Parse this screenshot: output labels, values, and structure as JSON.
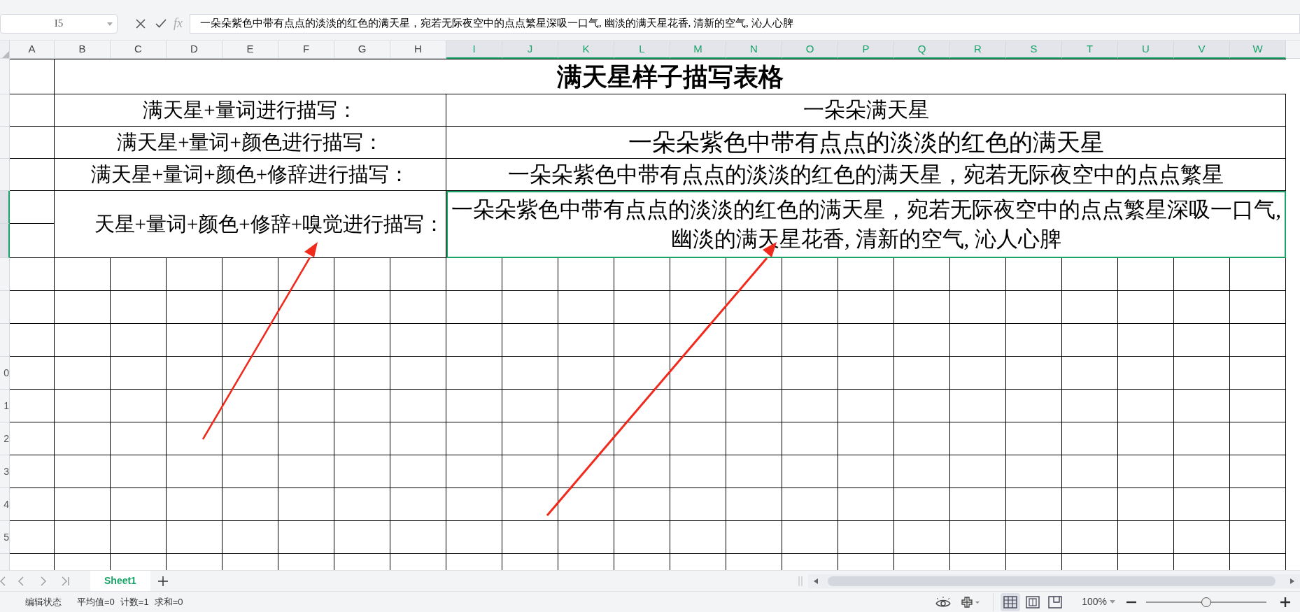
{
  "name_box": {
    "value": "I5"
  },
  "formula_bar": {
    "fx": "fx",
    "value": "一朵朵紫色中带有点点的淡淡的红色的满天星，宛若无际夜空中的点点繁星深吸一口气, 幽淡的满天星花香, 清新的空气, 沁人心脾"
  },
  "columns": [
    {
      "label": "A",
      "selected": false
    },
    {
      "label": "B",
      "selected": false
    },
    {
      "label": "C",
      "selected": false
    },
    {
      "label": "D",
      "selected": false
    },
    {
      "label": "E",
      "selected": false
    },
    {
      "label": "F",
      "selected": false
    },
    {
      "label": "G",
      "selected": false
    },
    {
      "label": "H",
      "selected": false
    },
    {
      "label": "I",
      "selected": true
    },
    {
      "label": "J",
      "selected": true
    },
    {
      "label": "K",
      "selected": true
    },
    {
      "label": "L",
      "selected": true
    },
    {
      "label": "M",
      "selected": true
    },
    {
      "label": "N",
      "selected": true
    },
    {
      "label": "O",
      "selected": true
    },
    {
      "label": "P",
      "selected": true
    },
    {
      "label": "Q",
      "selected": true
    },
    {
      "label": "R",
      "selected": true
    },
    {
      "label": "S",
      "selected": true
    },
    {
      "label": "T",
      "selected": true
    },
    {
      "label": "U",
      "selected": true
    },
    {
      "label": "V",
      "selected": true
    },
    {
      "label": "W",
      "selected": true
    }
  ],
  "row_headers": [
    {
      "selected": false
    },
    {
      "selected": false
    },
    {
      "selected": false
    },
    {
      "selected": false
    },
    {
      "selected": true
    },
    {
      "selected": true
    },
    {
      "selected": false
    },
    {
      "selected": false
    },
    {
      "selected": false
    },
    {
      "label": "0",
      "selected": false
    },
    {
      "label": "1",
      "selected": false
    },
    {
      "label": "2",
      "selected": false
    },
    {
      "label": "3",
      "selected": false
    },
    {
      "label": "4",
      "selected": false
    },
    {
      "label": "5",
      "selected": false
    },
    {
      "selected": false
    }
  ],
  "sheet": {
    "title": "满天星样子描写表格",
    "entries": [
      {
        "label": "满天星+量词进行描写：",
        "value": "一朵朵满天星",
        "selected": false
      },
      {
        "label": "满天星+量词+颜色进行描写：",
        "value": "一朵朵紫色中带有点点的淡淡的红色的满天星",
        "selected": false
      },
      {
        "label": "满天星+量词+颜色+修辞进行描写：",
        "value": "一朵朵紫色中带有点点的淡淡的红色的满天星，宛若无际夜空中的点点繁星",
        "selected": false
      },
      {
        "label": "天星+量词+颜色+修辞+嗅觉进行描写：",
        "value": "一朵朵紫色中带有点点的淡淡的红色的满天星，宛若无际夜空中的点点繁星深吸一口气, 幽淡的满天星花香, 清新的空气, 沁人心脾",
        "selected": true
      }
    ]
  },
  "sheet_tabs": [
    {
      "label": "Sheet1",
      "selected": true
    }
  ],
  "status_bar": {
    "mode": "编辑状态",
    "stats": [
      "平均值=0",
      "计数=1",
      "求和=0"
    ],
    "view_modes": [
      {
        "kind": "normal",
        "selected": true
      },
      {
        "kind": "page-break",
        "selected": false
      },
      {
        "kind": "page-layout",
        "selected": false
      }
    ],
    "zoom": "100%",
    "zoom_slider": {
      "level": 0.5
    }
  }
}
